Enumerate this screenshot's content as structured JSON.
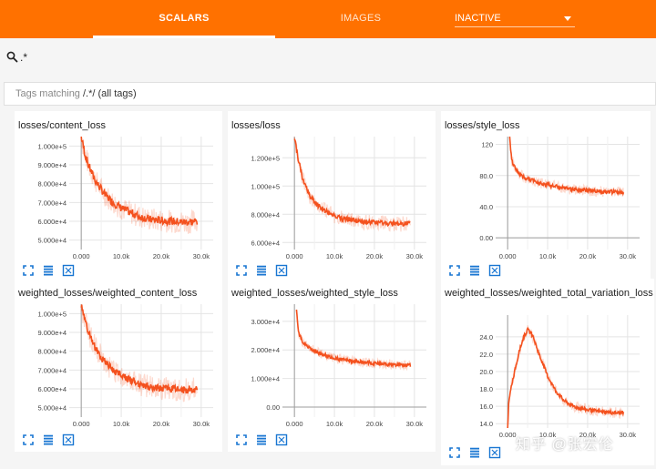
{
  "header": {
    "tab_scalars": "SCALARS",
    "tab_images": "IMAGES",
    "run_select": "INACTIVE",
    "accent_color": "#ff7100"
  },
  "search": {
    "query": ".*",
    "icon": "search-icon"
  },
  "tags_bar": {
    "prefix": "Tags matching ",
    "pattern": "/.*/",
    "suffix": " (all tags)"
  },
  "card_icons": [
    "expand-icon",
    "list-icon",
    "fit-domain-icon"
  ],
  "series_color": "#f4511e",
  "watermark": "知乎 @张宏伦",
  "cards": [
    {
      "title": "losses/content_loss",
      "chart_data": {
        "type": "line",
        "xlim": [
          -3000,
          33000
        ],
        "ylim": [
          45000,
          105000
        ],
        "xticks": [
          "0.000",
          "10.0k",
          "20.0k",
          "30.0k"
        ],
        "xtick_values": [
          0,
          10000,
          20000,
          30000
        ],
        "yticks": [
          "5.000e+4",
          "6.000e+4",
          "7.000e+4",
          "8.000e+4",
          "9.000e+4",
          "1.000e+5"
        ],
        "ytick_values": [
          50000,
          60000,
          70000,
          80000,
          90000,
          100000
        ],
        "x": [
          0,
          1000,
          2000,
          3000,
          4000,
          6000,
          8000,
          10000,
          12000,
          14000,
          17000,
          20000,
          23000,
          26000,
          29000
        ],
        "y": [
          105000,
          95000,
          89000,
          84000,
          80000,
          74000,
          70000,
          67000,
          65000,
          63000,
          61000,
          60500,
          60000,
          59500,
          60000
        ],
        "noise": 3500
      }
    },
    {
      "title": "losses/loss",
      "chart_data": {
        "type": "line",
        "xlim": [
          -3000,
          33000
        ],
        "ylim": [
          55000,
          135000
        ],
        "xticks": [
          "0.000",
          "10.0k",
          "20.0k",
          "30.0k"
        ],
        "xtick_values": [
          0,
          10000,
          20000,
          30000
        ],
        "yticks": [
          "6.000e+4",
          "8.000e+4",
          "1.000e+5",
          "1.200e+5"
        ],
        "ytick_values": [
          60000,
          80000,
          100000,
          120000
        ],
        "x": [
          0,
          1000,
          2000,
          3000,
          4000,
          6000,
          8000,
          10000,
          12000,
          14000,
          17000,
          20000,
          23000,
          26000,
          29000
        ],
        "y": [
          135000,
          118000,
          106000,
          98000,
          92000,
          86000,
          82000,
          79000,
          77000,
          76000,
          74500,
          74000,
          73500,
          73000,
          73500
        ],
        "noise": 3000
      }
    },
    {
      "title": "losses/style_loss",
      "chart_data": {
        "type": "line",
        "xlim": [
          -3000,
          33000
        ],
        "ylim": [
          -15,
          130
        ],
        "xticks": [
          "0.000",
          "10.0k",
          "20.0k",
          "30.0k"
        ],
        "xtick_values": [
          0,
          10000,
          20000,
          30000
        ],
        "yticks": [
          "0.00",
          "40.0",
          "80.0",
          "120"
        ],
        "ytick_values": [
          0,
          40,
          80,
          120
        ],
        "x": [
          500,
          1000,
          2000,
          3000,
          4000,
          6000,
          8000,
          10000,
          12000,
          14000,
          17000,
          20000,
          23000,
          26000,
          29000
        ],
        "y": [
          130,
          100,
          88,
          82,
          78,
          74,
          71,
          68,
          66,
          64,
          62,
          61,
          60,
          59,
          58
        ],
        "noise": 4
      }
    },
    {
      "title": "weighted_losses/weighted_content_loss",
      "chart_data": {
        "type": "line",
        "xlim": [
          -3000,
          33000
        ],
        "ylim": [
          45000,
          105000
        ],
        "xticks": [
          "0.000",
          "10.0k",
          "20.0k",
          "30.0k"
        ],
        "xtick_values": [
          0,
          10000,
          20000,
          30000
        ],
        "yticks": [
          "5.000e+4",
          "6.000e+4",
          "7.000e+4",
          "8.000e+4",
          "9.000e+4",
          "1.000e+5"
        ],
        "ytick_values": [
          50000,
          60000,
          70000,
          80000,
          90000,
          100000
        ],
        "x": [
          0,
          1000,
          2000,
          3000,
          4000,
          6000,
          8000,
          10000,
          12000,
          14000,
          17000,
          20000,
          23000,
          26000,
          29000
        ],
        "y": [
          105000,
          95000,
          89000,
          84000,
          80000,
          74000,
          70000,
          67000,
          65000,
          63000,
          61000,
          60500,
          60000,
          59500,
          60000
        ],
        "noise": 3500
      }
    },
    {
      "title": "weighted_losses/weighted_style_loss",
      "chart_data": {
        "type": "line",
        "xlim": [
          -3000,
          33000
        ],
        "ylim": [
          -3500,
          36000
        ],
        "xticks": [
          "0.000",
          "10.0k",
          "20.0k",
          "30.0k"
        ],
        "xtick_values": [
          0,
          10000,
          20000,
          30000
        ],
        "yticks": [
          "0.00",
          "1.000e+4",
          "2.000e+4",
          "3.000e+4"
        ],
        "ytick_values": [
          0,
          10000,
          20000,
          30000
        ],
        "x": [
          500,
          1000,
          2000,
          3000,
          4000,
          6000,
          8000,
          10000,
          12000,
          14000,
          17000,
          20000,
          23000,
          26000,
          29000
        ],
        "y": [
          34000,
          26000,
          23000,
          21500,
          20500,
          19000,
          18000,
          17200,
          16600,
          16200,
          15700,
          15300,
          15000,
          14800,
          14600
        ],
        "noise": 1000
      }
    },
    {
      "title": "weighted_losses/weighted_total_variation_loss",
      "chart_data": {
        "type": "line",
        "xlim": [
          -3000,
          33000
        ],
        "ylim": [
          13.5,
          26.5
        ],
        "xticks": [
          "0.000",
          "10.0k",
          "20.0k",
          "30.0k"
        ],
        "xtick_values": [
          0,
          10000,
          20000,
          30000
        ],
        "yticks": [
          "14.0",
          "16.0",
          "18.0",
          "20.0",
          "22.0",
          "24.0"
        ],
        "ytick_values": [
          14,
          16,
          18,
          20,
          22,
          24
        ],
        "x": [
          0,
          300,
          1000,
          2000,
          3000,
          4000,
          5000,
          6000,
          7000,
          8000,
          10000,
          12000,
          14000,
          16000,
          18000,
          20000,
          23000,
          26000,
          29000
        ],
        "y": [
          13.5,
          16.5,
          18.5,
          20.5,
          22.5,
          24.0,
          24.8,
          24.3,
          23.2,
          21.8,
          19.5,
          17.8,
          16.7,
          16.1,
          15.8,
          15.6,
          15.4,
          15.3,
          15.2
        ],
        "noise": 0.35
      }
    }
  ]
}
